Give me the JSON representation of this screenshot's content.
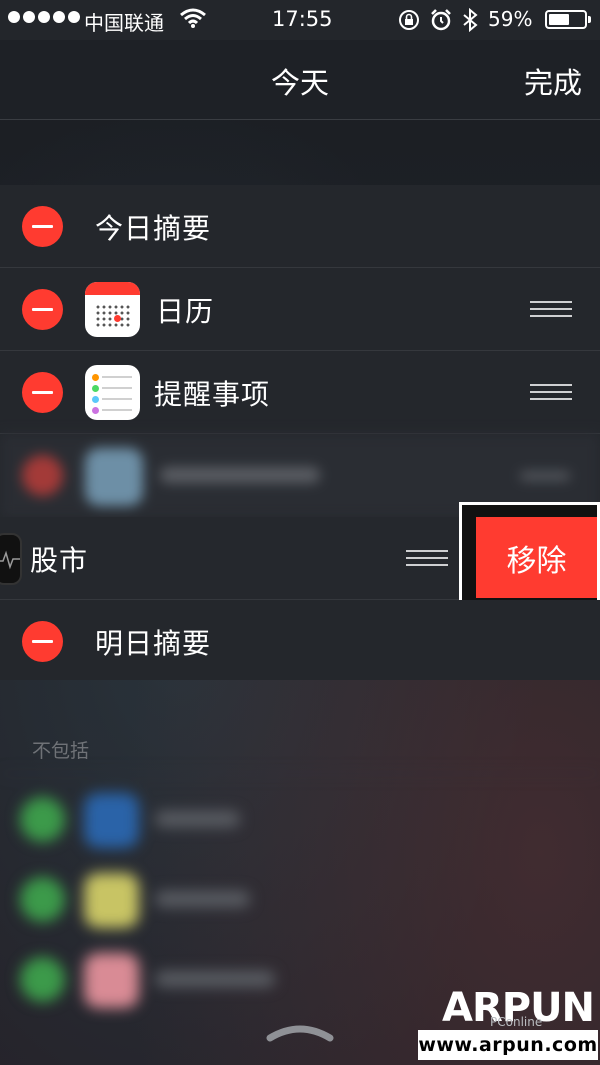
{
  "status_bar": {
    "carrier": "中国联通",
    "time": "17:55",
    "battery": "59%",
    "battery_level": 0.59
  },
  "nav": {
    "title": "今天",
    "done": "完成"
  },
  "widgets": [
    {
      "label": "今日摘要",
      "icon": null,
      "reorderable": false
    },
    {
      "label": "日历",
      "icon": "calendar-icon",
      "reorderable": true
    },
    {
      "label": "提醒事项",
      "icon": "reminders-icon",
      "reorderable": true
    },
    {
      "label": "",
      "icon": "blurred-app-icon",
      "reorderable": true
    },
    {
      "label": "股市",
      "icon": "stocks-icon",
      "reorderable": true
    },
    {
      "label": "明日摘要",
      "icon": null,
      "reorderable": false
    }
  ],
  "remove_button": "移除",
  "excluded_section": {
    "header": "不包括"
  },
  "watermark": {
    "brand": "ARPUN",
    "sub": "PConline",
    "url": "www.arpun.com"
  },
  "colors": {
    "accent_red": "#ff3b30",
    "background": "#202329"
  }
}
